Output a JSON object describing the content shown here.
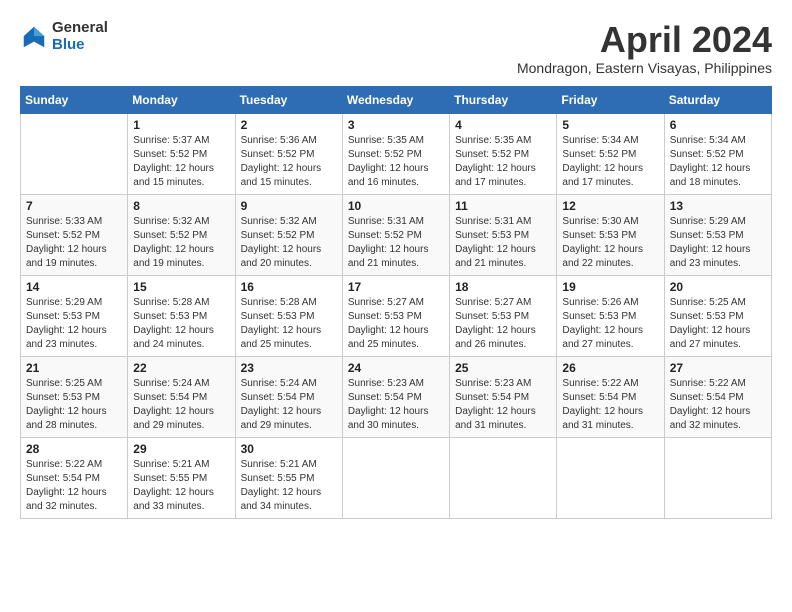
{
  "logo": {
    "general": "General",
    "blue": "Blue"
  },
  "title": "April 2024",
  "location": "Mondragon, Eastern Visayas, Philippines",
  "weekdays": [
    "Sunday",
    "Monday",
    "Tuesday",
    "Wednesday",
    "Thursday",
    "Friday",
    "Saturday"
  ],
  "weeks": [
    [
      {
        "day": "",
        "sunrise": "",
        "sunset": "",
        "daylight": ""
      },
      {
        "day": "1",
        "sunrise": "Sunrise: 5:37 AM",
        "sunset": "Sunset: 5:52 PM",
        "daylight": "Daylight: 12 hours and 15 minutes."
      },
      {
        "day": "2",
        "sunrise": "Sunrise: 5:36 AM",
        "sunset": "Sunset: 5:52 PM",
        "daylight": "Daylight: 12 hours and 15 minutes."
      },
      {
        "day": "3",
        "sunrise": "Sunrise: 5:35 AM",
        "sunset": "Sunset: 5:52 PM",
        "daylight": "Daylight: 12 hours and 16 minutes."
      },
      {
        "day": "4",
        "sunrise": "Sunrise: 5:35 AM",
        "sunset": "Sunset: 5:52 PM",
        "daylight": "Daylight: 12 hours and 17 minutes."
      },
      {
        "day": "5",
        "sunrise": "Sunrise: 5:34 AM",
        "sunset": "Sunset: 5:52 PM",
        "daylight": "Daylight: 12 hours and 17 minutes."
      },
      {
        "day": "6",
        "sunrise": "Sunrise: 5:34 AM",
        "sunset": "Sunset: 5:52 PM",
        "daylight": "Daylight: 12 hours and 18 minutes."
      }
    ],
    [
      {
        "day": "7",
        "sunrise": "Sunrise: 5:33 AM",
        "sunset": "Sunset: 5:52 PM",
        "daylight": "Daylight: 12 hours and 19 minutes."
      },
      {
        "day": "8",
        "sunrise": "Sunrise: 5:32 AM",
        "sunset": "Sunset: 5:52 PM",
        "daylight": "Daylight: 12 hours and 19 minutes."
      },
      {
        "day": "9",
        "sunrise": "Sunrise: 5:32 AM",
        "sunset": "Sunset: 5:52 PM",
        "daylight": "Daylight: 12 hours and 20 minutes."
      },
      {
        "day": "10",
        "sunrise": "Sunrise: 5:31 AM",
        "sunset": "Sunset: 5:52 PM",
        "daylight": "Daylight: 12 hours and 21 minutes."
      },
      {
        "day": "11",
        "sunrise": "Sunrise: 5:31 AM",
        "sunset": "Sunset: 5:53 PM",
        "daylight": "Daylight: 12 hours and 21 minutes."
      },
      {
        "day": "12",
        "sunrise": "Sunrise: 5:30 AM",
        "sunset": "Sunset: 5:53 PM",
        "daylight": "Daylight: 12 hours and 22 minutes."
      },
      {
        "day": "13",
        "sunrise": "Sunrise: 5:29 AM",
        "sunset": "Sunset: 5:53 PM",
        "daylight": "Daylight: 12 hours and 23 minutes."
      }
    ],
    [
      {
        "day": "14",
        "sunrise": "Sunrise: 5:29 AM",
        "sunset": "Sunset: 5:53 PM",
        "daylight": "Daylight: 12 hours and 23 minutes."
      },
      {
        "day": "15",
        "sunrise": "Sunrise: 5:28 AM",
        "sunset": "Sunset: 5:53 PM",
        "daylight": "Daylight: 12 hours and 24 minutes."
      },
      {
        "day": "16",
        "sunrise": "Sunrise: 5:28 AM",
        "sunset": "Sunset: 5:53 PM",
        "daylight": "Daylight: 12 hours and 25 minutes."
      },
      {
        "day": "17",
        "sunrise": "Sunrise: 5:27 AM",
        "sunset": "Sunset: 5:53 PM",
        "daylight": "Daylight: 12 hours and 25 minutes."
      },
      {
        "day": "18",
        "sunrise": "Sunrise: 5:27 AM",
        "sunset": "Sunset: 5:53 PM",
        "daylight": "Daylight: 12 hours and 26 minutes."
      },
      {
        "day": "19",
        "sunrise": "Sunrise: 5:26 AM",
        "sunset": "Sunset: 5:53 PM",
        "daylight": "Daylight: 12 hours and 27 minutes."
      },
      {
        "day": "20",
        "sunrise": "Sunrise: 5:25 AM",
        "sunset": "Sunset: 5:53 PM",
        "daylight": "Daylight: 12 hours and 27 minutes."
      }
    ],
    [
      {
        "day": "21",
        "sunrise": "Sunrise: 5:25 AM",
        "sunset": "Sunset: 5:53 PM",
        "daylight": "Daylight: 12 hours and 28 minutes."
      },
      {
        "day": "22",
        "sunrise": "Sunrise: 5:24 AM",
        "sunset": "Sunset: 5:54 PM",
        "daylight": "Daylight: 12 hours and 29 minutes."
      },
      {
        "day": "23",
        "sunrise": "Sunrise: 5:24 AM",
        "sunset": "Sunset: 5:54 PM",
        "daylight": "Daylight: 12 hours and 29 minutes."
      },
      {
        "day": "24",
        "sunrise": "Sunrise: 5:23 AM",
        "sunset": "Sunset: 5:54 PM",
        "daylight": "Daylight: 12 hours and 30 minutes."
      },
      {
        "day": "25",
        "sunrise": "Sunrise: 5:23 AM",
        "sunset": "Sunset: 5:54 PM",
        "daylight": "Daylight: 12 hours and 31 minutes."
      },
      {
        "day": "26",
        "sunrise": "Sunrise: 5:22 AM",
        "sunset": "Sunset: 5:54 PM",
        "daylight": "Daylight: 12 hours and 31 minutes."
      },
      {
        "day": "27",
        "sunrise": "Sunrise: 5:22 AM",
        "sunset": "Sunset: 5:54 PM",
        "daylight": "Daylight: 12 hours and 32 minutes."
      }
    ],
    [
      {
        "day": "28",
        "sunrise": "Sunrise: 5:22 AM",
        "sunset": "Sunset: 5:54 PM",
        "daylight": "Daylight: 12 hours and 32 minutes."
      },
      {
        "day": "29",
        "sunrise": "Sunrise: 5:21 AM",
        "sunset": "Sunset: 5:55 PM",
        "daylight": "Daylight: 12 hours and 33 minutes."
      },
      {
        "day": "30",
        "sunrise": "Sunrise: 5:21 AM",
        "sunset": "Sunset: 5:55 PM",
        "daylight": "Daylight: 12 hours and 34 minutes."
      },
      {
        "day": "",
        "sunrise": "",
        "sunset": "",
        "daylight": ""
      },
      {
        "day": "",
        "sunrise": "",
        "sunset": "",
        "daylight": ""
      },
      {
        "day": "",
        "sunrise": "",
        "sunset": "",
        "daylight": ""
      },
      {
        "day": "",
        "sunrise": "",
        "sunset": "",
        "daylight": ""
      }
    ]
  ]
}
